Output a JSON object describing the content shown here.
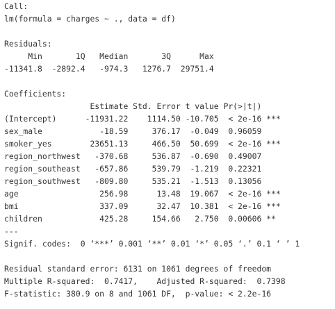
{
  "output": {
    "lines": [
      "Call:",
      "lm(formula = charges ~ ., data = df)",
      "",
      "Residuals:",
      "     Min       1Q   Median       3Q      Max ",
      "-11341.8  -2892.4   -974.3   1276.7  29751.4 ",
      "",
      "Coefficients:",
      "                  Estimate Std. Error t value Pr(>|t|)    ",
      "(Intercept)      -11931.22    1114.50 -10.705  < 2e-16 ***",
      "sex_male            -18.59     376.17  -0.049  0.96059    ",
      "smoker_yes        23651.13     466.50  50.699  < 2e-16 ***",
      "region_northwest   -370.68     536.87  -0.690  0.49007    ",
      "region_southeast   -657.86     539.79  -1.219  0.22321    ",
      "region_southwest   -809.80     535.21  -1.513  0.13056    ",
      "age                 256.98      13.48  19.067  < 2e-16 ***",
      "bmi                 337.09      32.47  10.381  < 2e-16 ***",
      "children            425.28     154.66   2.750  0.00606 ** ",
      "---",
      "Signif. codes:  0 ‘***’ 0.001 ‘**’ 0.01 ‘*’ 0.05 ‘.’ 0.1 ‘ ’ 1",
      "",
      "Residual standard error: 6131 on 1061 degrees of freedom",
      "Multiple R-squared:  0.7417,    Adjusted R-squared:  0.7398 ",
      "F-statistic: 380.9 on 8 and 1061 DF,  p-value: < 2.2e-16"
    ]
  }
}
